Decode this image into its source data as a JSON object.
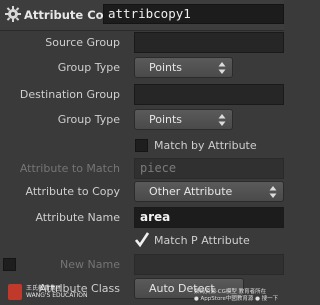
{
  "header": {
    "node_type": "Attribute Copy",
    "node_name": "attribcopy1"
  },
  "params": {
    "source_group": {
      "label": "Source Group",
      "value": ""
    },
    "source_group_type": {
      "label": "Group Type",
      "value": "Points"
    },
    "destination_group": {
      "label": "Destination Group",
      "value": ""
    },
    "destination_group_type": {
      "label": "Group Type",
      "value": "Points"
    },
    "match_by_attribute": {
      "label": "Match by Attribute",
      "checked": false
    },
    "attribute_to_match": {
      "label": "Attribute to Match",
      "value": "piece",
      "enabled": false
    },
    "attribute_to_copy": {
      "label": "Attribute to Copy",
      "value": "Other Attribute"
    },
    "attribute_name": {
      "label": "Attribute Name",
      "value": "area"
    },
    "match_p_attribute": {
      "label": "Match P Attribute",
      "checked": true
    },
    "new_name": {
      "label": "New Name",
      "value": "",
      "enabled": false,
      "checked": false
    },
    "attribute_class": {
      "label": "Attribute Class",
      "value": "Auto Detect"
    }
  },
  "watermark": {
    "left_line1": "王氏教育集团",
    "left_line2": "WANG'S EDUCATION",
    "right_line1": "数码资源·CG模型 教育者所在",
    "right_line2": "● AppStore中國教育源   ● 搜一下"
  },
  "icons": {
    "node_icon": "gear-icon",
    "menu_arrows": "up-down-arrows-icon",
    "checkmark": "checkmark-icon"
  },
  "colors": {
    "background": "#3a3a3a",
    "field_background": "#262626",
    "menu_background": "#505050",
    "text": "#cfcfcf",
    "disabled_text": "#757575"
  }
}
